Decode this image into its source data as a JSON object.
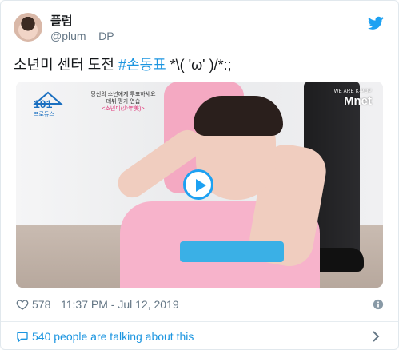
{
  "author": {
    "display_name": "플럼",
    "handle": "@plum__DP"
  },
  "tweet": {
    "text_prefix": "소년미 센터 도전 ",
    "hashtag": "#손동표",
    "text_suffix": " *\\( 'ω' )/*:;"
  },
  "video": {
    "logo_text": "101",
    "logo_sub": "프로듀스",
    "caption_line1": "당신의 소년에게 투표하세요",
    "caption_line2": "데뷔 평가 연습",
    "caption_line3": "<소년미(少年美)>",
    "mnet_small": "WE ARE K-POP",
    "mnet_big": "Mnet"
  },
  "meta": {
    "likes": "578",
    "datetime": "11:37 PM - Jul 12, 2019"
  },
  "footer": {
    "talking": "540 people are talking about this"
  },
  "colors": {
    "accent": "#1da1f2",
    "link": "#1b95e0",
    "muted": "#657786"
  }
}
